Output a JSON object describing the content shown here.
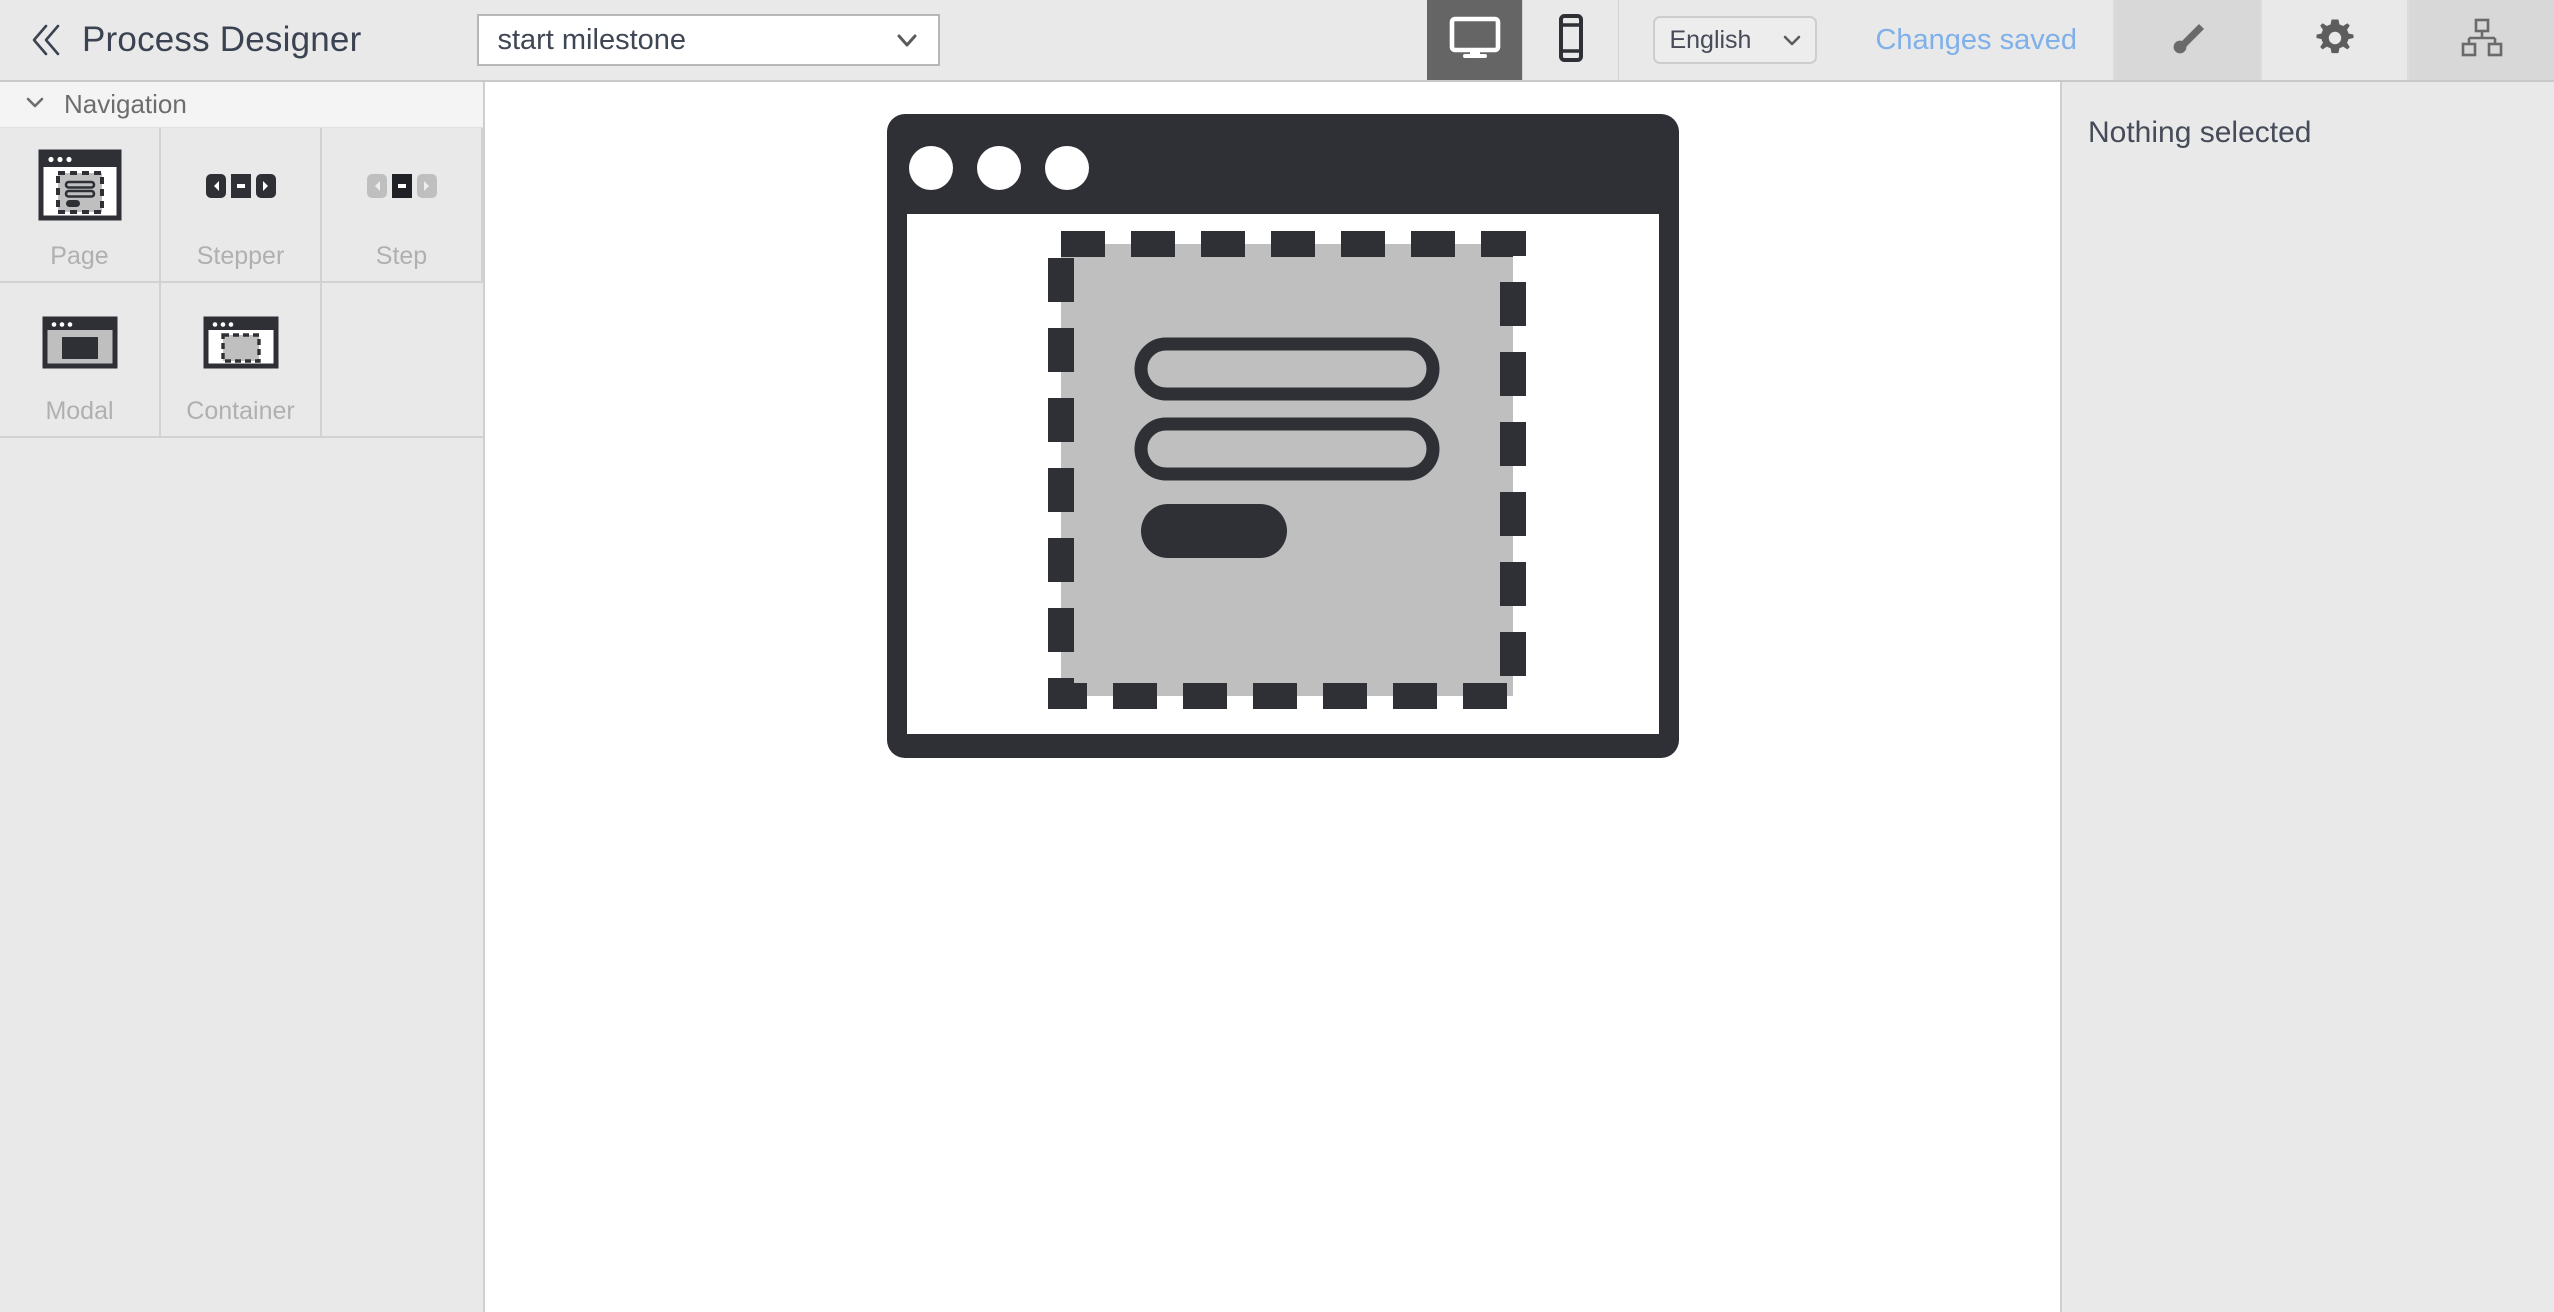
{
  "app": {
    "title": "Process Designer",
    "back_icon": "double-chevron-left-icon"
  },
  "topbar": {
    "milestone_select": {
      "value": "start milestone",
      "placeholder": "start milestone",
      "chevron_icon": "chevron-down-icon"
    },
    "view_modes": [
      {
        "name": "desktop",
        "icon": "desktop-monitor-icon",
        "active": true
      },
      {
        "name": "mobile",
        "icon": "mobile-phone-icon",
        "active": false
      }
    ],
    "language_select": {
      "value": "English",
      "chevron_icon": "chevron-down-icon"
    },
    "save_status": "Changes saved",
    "save_status_color": "#7fb0e9",
    "right_tabs": [
      {
        "name": "style",
        "icon": "paintbrush-icon",
        "selected": false
      },
      {
        "name": "settings",
        "icon": "gear-icon",
        "selected": true
      },
      {
        "name": "structure",
        "icon": "sitemap-hierarchy-icon",
        "selected": false
      }
    ]
  },
  "palette": {
    "section": {
      "label": "Navigation",
      "chevron_icon": "chevron-down-icon",
      "expanded": true
    },
    "items": [
      {
        "label": "Page",
        "icon": "page-window-icon"
      },
      {
        "label": "Stepper",
        "icon": "stepper-icon"
      },
      {
        "label": "Step",
        "icon": "step-icon"
      },
      {
        "label": "Modal",
        "icon": "modal-window-icon"
      },
      {
        "label": "Container",
        "icon": "container-window-icon"
      }
    ]
  },
  "canvas": {
    "preview_name": "page-preview-illustration",
    "window_dots": 3,
    "fields": 2,
    "buttons": 1,
    "colors": {
      "frame": "#2e3036",
      "surface": "#ffffff",
      "container_fill": "#bfbfbf",
      "canvas_bg": "#ffffff"
    }
  },
  "inspector": {
    "empty_message": "Nothing selected"
  },
  "theme": {
    "chrome_bg": "#e9e9e9",
    "panel_bg": "#e9e9e9",
    "section_bg": "#f4f4f4",
    "accent_blue": "#7fb0e9",
    "text_dark": "#3b4251",
    "text_muted": "#b0b0b0",
    "icon_dark": "#2e3036",
    "active_btn_bg": "#656565"
  }
}
